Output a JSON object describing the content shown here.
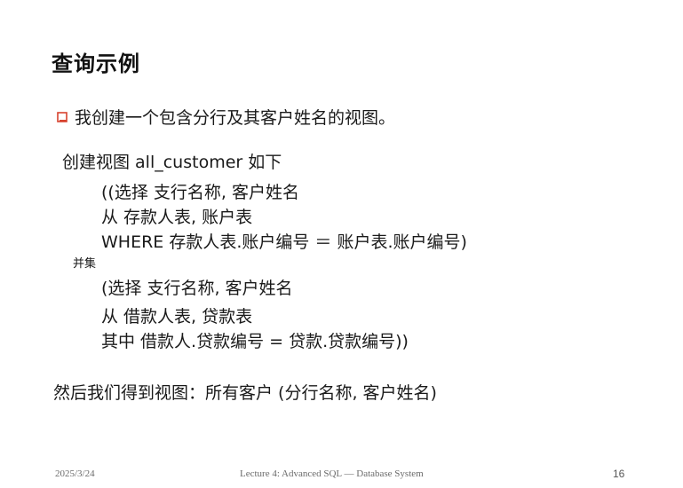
{
  "slide": {
    "title": "查询示例",
    "bullet": {
      "icon": "square-bullet-icon",
      "color": "#d7432f",
      "text": "我创建一个包含分行及其客户姓名的视图。"
    },
    "code_lines": [
      "创建视图 all_customer 如下",
      "((选择 支行名称, 客户姓名",
      "从 存款人表, 账户表",
      "WHERE 存款人表.账户编号 ＝ 账户表.账户编号)",
      "并集",
      "(选择 支行名称, 客户姓名",
      "从 借款人表, 贷款表",
      "其中 借款人.贷款编号 = 贷款.贷款编号))"
    ],
    "conclusion": "然后我们得到视图：所有客户 (分行名称, 客户姓名)"
  },
  "footer": {
    "date": "2025/3/24",
    "center": "Lecture 4: Advanced SQL — Database System",
    "page": "16"
  }
}
